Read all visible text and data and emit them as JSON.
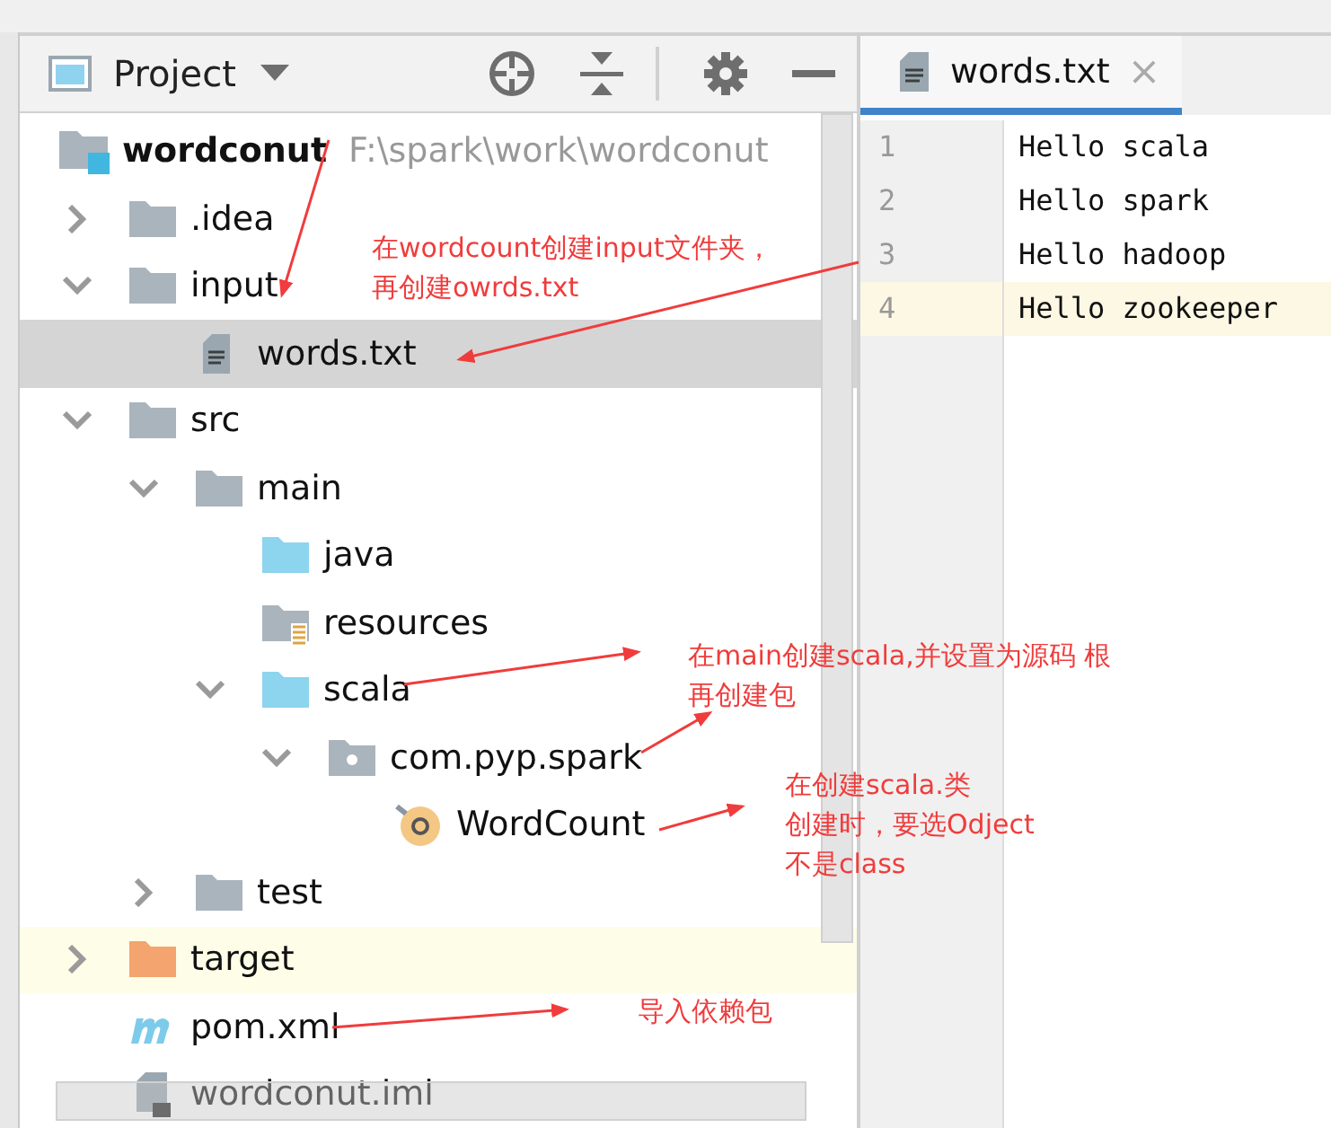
{
  "project_panel": {
    "title": "Project"
  },
  "tree": [
    {
      "label": "wordconut",
      "path": "F:\\spark\\work\\wordconut",
      "kind": "module",
      "selected": false,
      "highlighted": false,
      "children": [
        {
          "label": ".idea",
          "kind": "folder",
          "expanded": false,
          "selected": false,
          "highlighted": false
        },
        {
          "label": "input",
          "kind": "folder",
          "expanded": true,
          "selected": false,
          "highlighted": false,
          "children": [
            {
              "label": "words.txt",
              "kind": "text-file",
              "selected": true,
              "highlighted": false
            }
          ]
        },
        {
          "label": "src",
          "kind": "folder",
          "expanded": true,
          "selected": false,
          "highlighted": false,
          "children": [
            {
              "label": "main",
              "kind": "folder",
              "expanded": true,
              "selected": false,
              "highlighted": false,
              "children": [
                {
                  "label": "java",
                  "kind": "source-folder",
                  "selected": false,
                  "highlighted": false
                },
                {
                  "label": "resources",
                  "kind": "resource-folder",
                  "selected": false,
                  "highlighted": false
                },
                {
                  "label": "scala",
                  "kind": "source-folder",
                  "expanded": true,
                  "selected": false,
                  "highlighted": false,
                  "children": [
                    {
                      "label": "com.pyp.spark",
                      "kind": "package",
                      "expanded": true,
                      "selected": false,
                      "highlighted": false,
                      "children": [
                        {
                          "label": "WordCount",
                          "kind": "object",
                          "selected": false,
                          "highlighted": false
                        }
                      ]
                    }
                  ]
                }
              ]
            },
            {
              "label": "test",
              "kind": "folder",
              "expanded": false,
              "selected": false,
              "highlighted": false
            }
          ]
        },
        {
          "label": "target",
          "kind": "excluded-folder",
          "expanded": false,
          "selected": false,
          "highlighted": true
        },
        {
          "label": "pom.xml",
          "kind": "maven-file",
          "selected": false,
          "highlighted": false
        },
        {
          "label": "wordconut.iml",
          "kind": "module-file",
          "selected": false,
          "highlighted": false
        }
      ]
    }
  ],
  "editor": {
    "tab": {
      "label": "words.txt",
      "close": "×",
      "selected": true
    },
    "lines": [
      {
        "number": "1",
        "text": "Hello scala",
        "current": false
      },
      {
        "number": "2",
        "text": "Hello spark",
        "current": false
      },
      {
        "number": "3",
        "text": "Hello hadoop",
        "current": false
      },
      {
        "number": "4",
        "text": "Hello zookeeper",
        "current": true
      }
    ]
  },
  "annotations": [
    {
      "lines": [
        "在wordcount创建input文件夹，",
        "再创建owrds.txt"
      ]
    },
    {
      "lines": [
        "在main创建scala,并设置为源码 根",
        "再创建包"
      ]
    },
    {
      "lines": [
        "在创建scala.类",
        "创建时，要选Odject",
        "不是class"
      ]
    },
    {
      "lines": [
        "导入依赖包"
      ]
    }
  ]
}
